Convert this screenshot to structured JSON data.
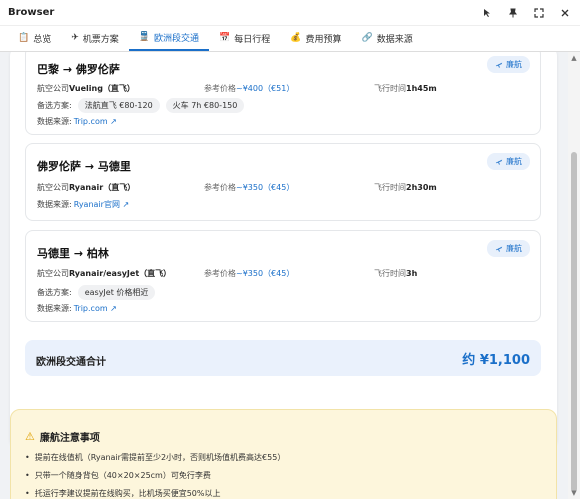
{
  "window": {
    "title": "Browser"
  },
  "tabs": [
    {
      "label": "总览",
      "icon": "clipboard-icon",
      "glyph": "📋"
    },
    {
      "label": "机票方案",
      "icon": "plane-icon",
      "glyph": "✈"
    },
    {
      "label": "欧洲段交通",
      "icon": "train-icon",
      "glyph": "🚆"
    },
    {
      "label": "每日行程",
      "icon": "calendar-icon",
      "glyph": "📅"
    },
    {
      "label": "费用预算",
      "icon": "money-bag-icon",
      "glyph": "💰"
    },
    {
      "label": "数据来源",
      "icon": "link-icon",
      "glyph": "🔗"
    }
  ],
  "routes": [
    {
      "name": "巴黎 → 佛罗伦萨",
      "badge": "廉航",
      "airline_label": "航空公司",
      "airline": "Vueling（直飞）",
      "price_label": "参考价格",
      "price": "~¥400（€51）",
      "flight_label": "飞行时间",
      "flight": "1h45m",
      "alt_label": "备选方案:",
      "alts": [
        "法航直飞 €80-120",
        "火车 7h €80-150"
      ],
      "source_label": "数据来源:",
      "source": "Trip.com ↗"
    },
    {
      "name": "佛罗伦萨 → 马德里",
      "badge": "廉航",
      "airline_label": "航空公司",
      "airline": "Ryanair（直飞）",
      "price_label": "参考价格",
      "price": "~¥350（€45）",
      "flight_label": "飞行时间",
      "flight": "2h30m",
      "source_label": "数据来源:",
      "source": "Ryanair官网 ↗"
    },
    {
      "name": "马德里 → 柏林",
      "badge": "廉航",
      "airline_label": "航空公司",
      "airline": "Ryanair/easyJet（直飞）",
      "price_label": "参考价格",
      "price": "~¥350（€45）",
      "flight_label": "飞行时间",
      "flight": "3h",
      "alt_label": "备选方案:",
      "alts": [
        "easyJet 价格相近"
      ],
      "source_label": "数据来源:",
      "source": "Trip.com ↗"
    }
  ],
  "total": {
    "label": "欧洲段交通合计",
    "amount": "约 ¥1,100"
  },
  "notes": {
    "title": "廉航注意事项",
    "items": [
      "提前在线值机（Ryanair需提前至少2小时，否则机场值机费高达€55）",
      "只带一个随身背包（40×20×25cm）可免行李费",
      "托运行李建议提前在线购买，比机场买便宜50%以上"
    ]
  }
}
